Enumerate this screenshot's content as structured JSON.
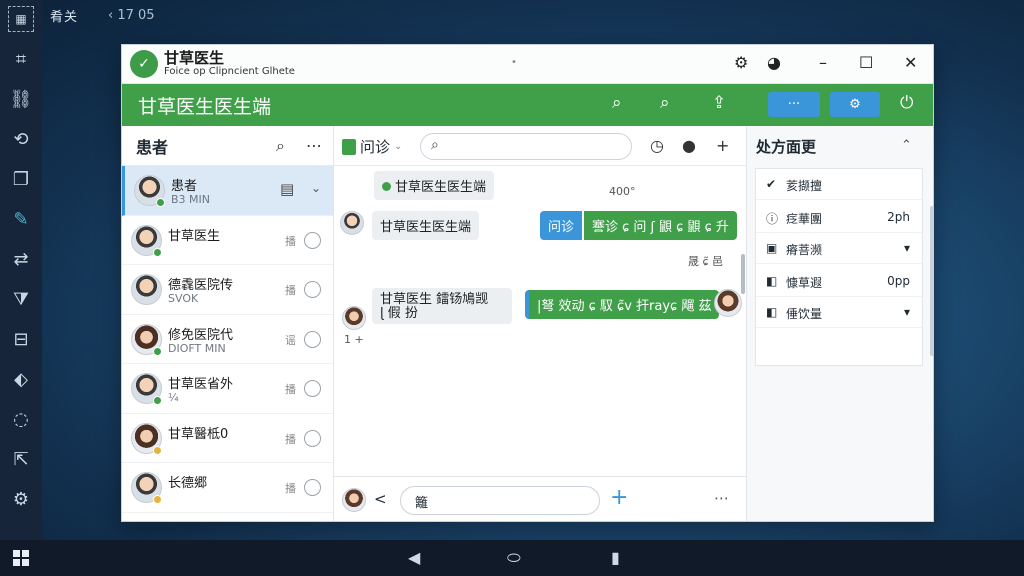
{
  "os": {
    "topbar_title": "肴关",
    "topbar_nav": "‹ 17 05"
  },
  "window": {
    "title_main": "甘草医生",
    "title_sub": "Foice op Clipncient Glhete",
    "dot": "•"
  },
  "header": {
    "title": "甘草医生医生端",
    "menu_button": "···"
  },
  "patients": {
    "title": "患者",
    "items": [
      {
        "name": "患者",
        "sub": "B3 MIN",
        "tag": "",
        "gender": "m",
        "status_color": "#40a04a"
      },
      {
        "name": "甘草医生",
        "sub": "",
        "tag": "播",
        "gender": "m",
        "status_color": "#40a04a"
      },
      {
        "name": "德毳医院传",
        "sub": "SVOK",
        "tag": "播",
        "gender": "m",
        "status_color": ""
      },
      {
        "name": "修免医院代",
        "sub": "DIOFT MIN",
        "tag": "谣",
        "gender": "f",
        "status_color": "#40a04a"
      },
      {
        "name": "甘草医省外",
        "sub": "¼",
        "tag": "播",
        "gender": "m",
        "status_color": "#40a04a"
      },
      {
        "name": "甘草醫柢0",
        "sub": "",
        "tag": "播",
        "gender": "f",
        "status_color": "#e8b33a"
      },
      {
        "name": "长德郷",
        "sub": "",
        "tag": "播",
        "gender": "m",
        "status_color": "#e8b33a"
      }
    ]
  },
  "chat": {
    "tab_label": "问诊",
    "messages": {
      "system_notice": "甘草医生医生端",
      "time_1": "400°",
      "in_1": "甘草医生医生端",
      "out_1_prefix": "问诊",
      "out_1": "謇诊 ɕ 问 ʃ 鼰 ɕ 鼰 ɕ 升",
      "status_1": "晟 ɕ̃ 邑",
      "in_2_line1": "甘草医生",
      "in_2_line2": "ɭ 假 扮",
      "in_2_rest": "鐳钖鳩觊",
      "out_2": "|弩 效动 ɕ 馭 ɕ̃v 扞rayɕ 飗 茲",
      "time_2": "1 +"
    },
    "composer_text": "籬"
  },
  "prescription": {
    "title": "处方面更",
    "rows": [
      {
        "label": "荄撷擅",
        "value": "",
        "icon": "✔"
      },
      {
        "label": "疺華團",
        "value": "2ph",
        "icon": "ⓘ"
      },
      {
        "label": "瘠菩濒",
        "value": "▾",
        "icon": "▣"
      },
      {
        "label": "慷草遐",
        "value": "0pp",
        "icon": "◧"
      },
      {
        "label": "倕饮量",
        "value": "▾",
        "icon": "◧"
      }
    ]
  },
  "colors": {
    "brand_green": "#40a04a",
    "accent_blue": "#3a96d8"
  }
}
